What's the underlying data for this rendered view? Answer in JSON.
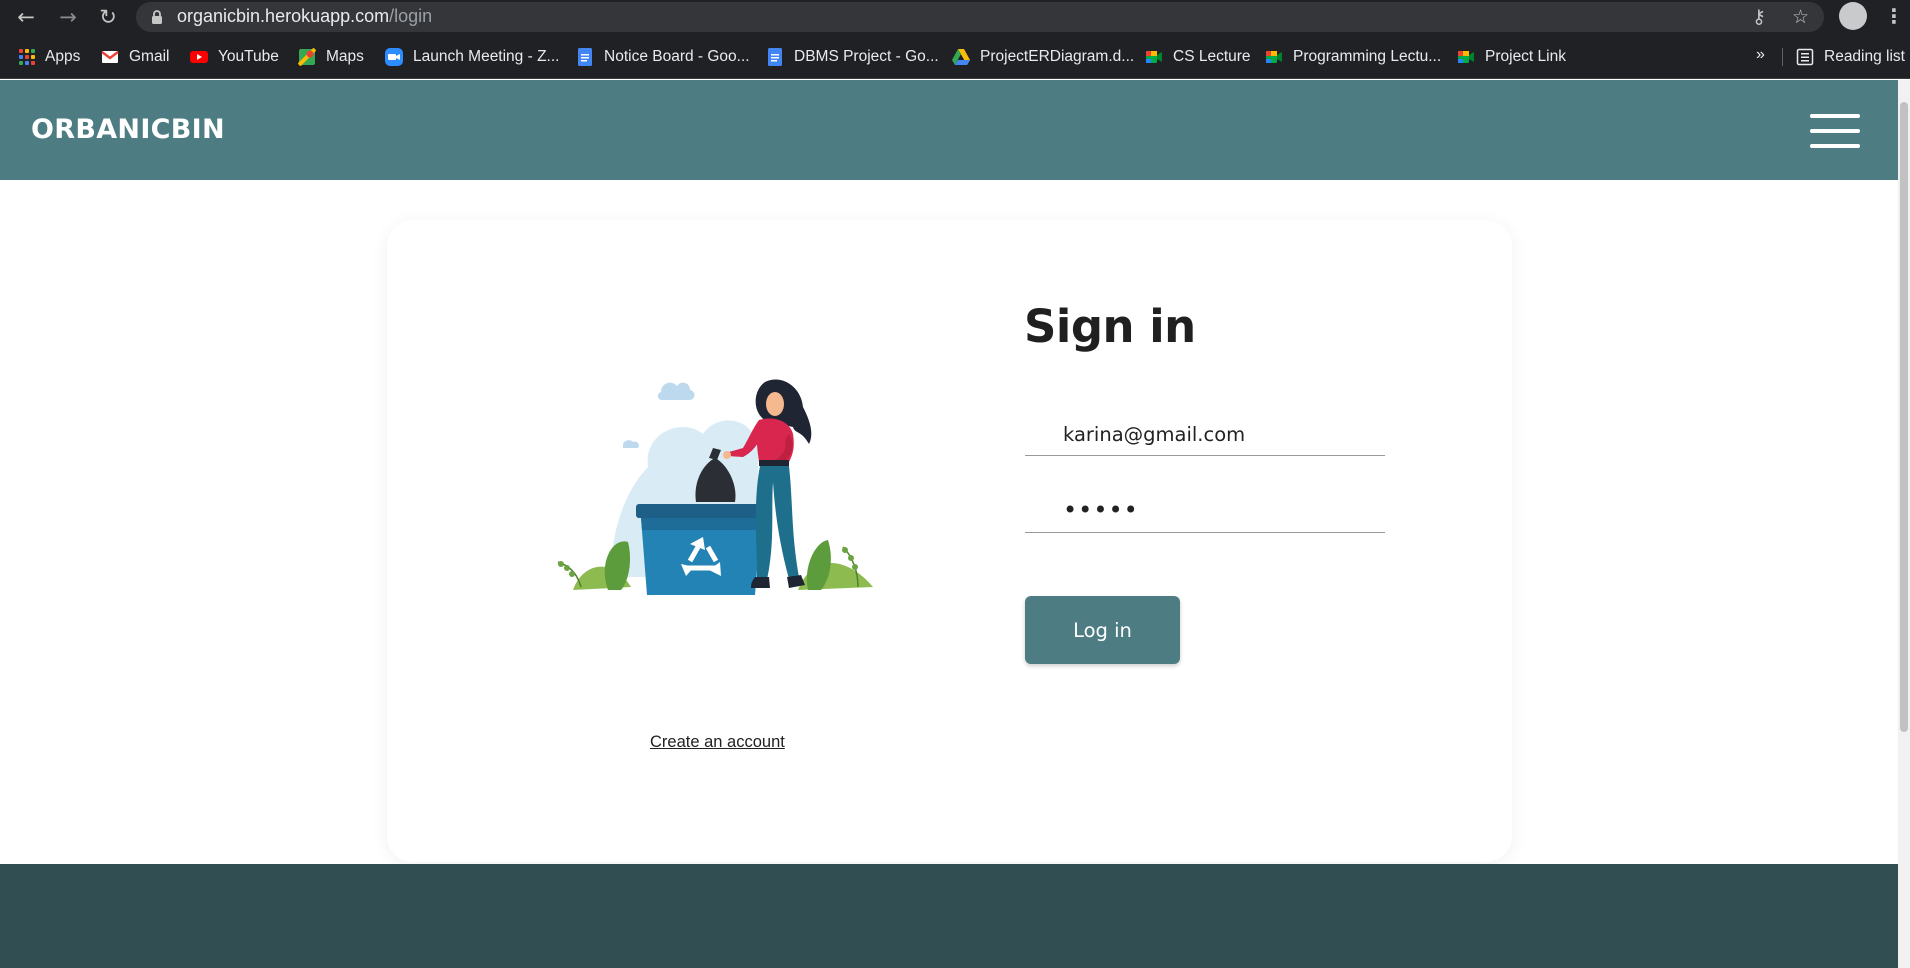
{
  "browser": {
    "back_icon": "arrow-left-icon",
    "forward_icon": "arrow-right-icon",
    "reload_icon": "reload-icon",
    "url_host": "organicbin.herokuapp.com",
    "url_path": "/login",
    "bookmarks": [
      {
        "label": "Apps",
        "icon": "apps-grid-icon"
      },
      {
        "label": "Gmail",
        "icon": "gmail-icon"
      },
      {
        "label": "YouTube",
        "icon": "youtube-icon"
      },
      {
        "label": "Maps",
        "icon": "maps-icon"
      },
      {
        "label": "Launch Meeting - Z...",
        "icon": "zoom-icon"
      },
      {
        "label": "Notice Board - Goo...",
        "icon": "google-docs-icon"
      },
      {
        "label": "DBMS Project - Go...",
        "icon": "google-docs-icon"
      },
      {
        "label": "ProjectERDiagram.d...",
        "icon": "google-drive-icon"
      },
      {
        "label": "CS Lecture",
        "icon": "google-meet-icon"
      },
      {
        "label": "Programming Lectu...",
        "icon": "google-meet-icon"
      },
      {
        "label": "Project Link",
        "icon": "google-meet-icon"
      }
    ],
    "more_bookmarks": "»",
    "reading_list": "Reading list"
  },
  "header": {
    "brand": "ORBANICBIN",
    "menu_icon": "hamburger-menu-icon"
  },
  "login": {
    "title": "Sign in",
    "email_value": "karina@gmail.com",
    "password_value": "•••••",
    "submit_label": "Log in",
    "create_account_label": "Create an account"
  },
  "colors": {
    "header_bg": "#4d7d82",
    "button_bg": "#4d7d82",
    "footer_bg": "#314f53"
  }
}
